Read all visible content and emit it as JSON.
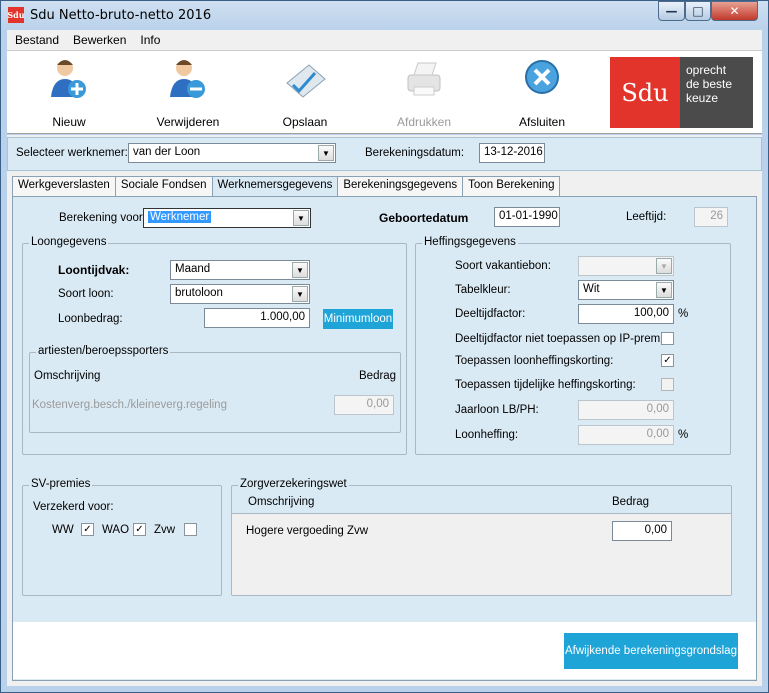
{
  "window": {
    "title": "Sdu Netto-bruto-netto 2016",
    "logo_text": "Sdu",
    "minimize": "—",
    "maximize": "□",
    "close": "✕"
  },
  "menu": [
    "Bestand",
    "Bewerken",
    "Info"
  ],
  "toolbar": {
    "nieuw": "Nieuw",
    "verwijderen": "Verwijderen",
    "opslaan": "Opslaan",
    "afdrukken": "Afdrukken",
    "afsluiten": "Afsluiten"
  },
  "brand": {
    "logo": "Sdu",
    "tagline_1": "oprecht",
    "tagline_2": "de beste",
    "tagline_3": "keuze"
  },
  "select": {
    "werknemer_label": "Selecteer werknemer:",
    "werknemer_value": "van der Loon",
    "datum_label": "Berekeningsdatum:",
    "datum_value": "13-12-2016"
  },
  "tabs": [
    "Werkgeverslasten",
    "Sociale Fondsen",
    "Werknemersgegevens",
    "Berekeningsgegevens",
    "Toon Berekening"
  ],
  "top": {
    "berekening_label": "Berekening voor:",
    "berekening_value": "Werknemer",
    "geboorte_label": "Geboortedatum",
    "geboorte_value": "01-01-1990",
    "leeftijd_label": "Leeftijd:",
    "leeftijd_value": "26"
  },
  "loon": {
    "title": "Loongegevens",
    "tijdvak_label": "Loontijdvak:",
    "tijdvak_value": "Maand",
    "soort_label": "Soort loon:",
    "soort_value": "brutoloon",
    "bedrag_label": "Loonbedrag:",
    "bedrag_value": "1.000,00",
    "minimum_button": "Minimumloon"
  },
  "artiesten": {
    "title": "artiesten/beroepssporters",
    "col_omschrijving": "Omschrijving",
    "col_bedrag": "Bedrag",
    "row_label": "Kostenverg.besch./kleineverg.regeling",
    "row_value": "0,00"
  },
  "heffing": {
    "title": "Heffingsgegevens",
    "vakantie_label": "Soort vakantiebon:",
    "vakantie_value": "",
    "tabel_label": "Tabelkleur:",
    "tabel_value": "Wit",
    "deeltijd_label": "Deeltijdfactor:",
    "deeltijd_value": "100,00",
    "pct": "%",
    "niet_ip_label": "Deeltijdfactor niet toepassen op IP-premie",
    "korting_label": "Toepassen loonheffingskorting:",
    "tijdelijk_label": "Toepassen tijdelijke heffingskorting:",
    "jaarloon_label": "Jaarloon LB/PH:",
    "jaarloon_value": "0,00",
    "loonheffing_label": "Loonheffing:",
    "loonheffing_value": "0,00",
    "pct2": "%"
  },
  "sv": {
    "title": "SV-premies",
    "verzekerd_label": "Verzekerd voor:",
    "ww": "WW",
    "wao": "WAO",
    "zvw": "Zvw",
    "check": "✓"
  },
  "zorg": {
    "title": "Zorgverzekeringswet",
    "col_omschrijving": "Omschrijving",
    "col_bedrag": "Bedrag",
    "row_label": "Hogere vergoeding Zvw",
    "row_value": "0,00"
  },
  "footer": {
    "button": "Afwijkende berekeningsgrondslag"
  }
}
